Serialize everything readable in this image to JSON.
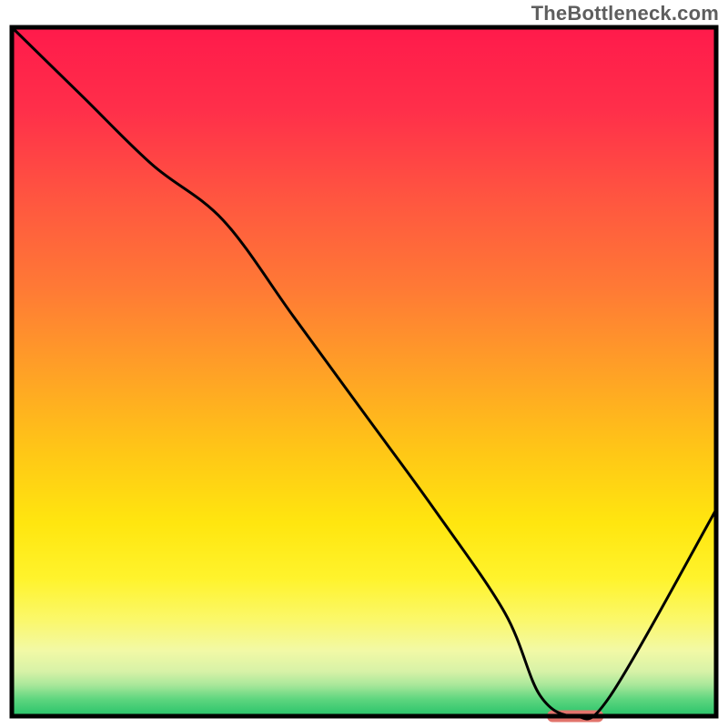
{
  "watermark": "TheBottleneck.com",
  "chart_data": {
    "type": "line",
    "title": "",
    "xlabel": "",
    "ylabel": "",
    "xlim": [
      0,
      100
    ],
    "ylim": [
      0,
      100
    ],
    "grid": false,
    "legend": false,
    "series": [
      {
        "name": "bottleneck-curve",
        "x": [
          0,
          10,
          20,
          30,
          40,
          50,
          60,
          70,
          75,
          80,
          85,
          100
        ],
        "y": [
          100,
          90,
          80,
          72,
          58,
          44,
          30,
          15,
          3,
          0,
          3,
          30
        ]
      }
    ],
    "marker": {
      "name": "optimal-range",
      "x_start": 76,
      "x_end": 84,
      "y": 0,
      "color": "#e2746c"
    },
    "background_gradient": {
      "stops": [
        {
          "offset": 0.0,
          "color": "#ff1a4b"
        },
        {
          "offset": 0.12,
          "color": "#ff2f4a"
        },
        {
          "offset": 0.25,
          "color": "#ff5640"
        },
        {
          "offset": 0.38,
          "color": "#ff7a35"
        },
        {
          "offset": 0.5,
          "color": "#ffa126"
        },
        {
          "offset": 0.62,
          "color": "#ffc816"
        },
        {
          "offset": 0.72,
          "color": "#ffe60f"
        },
        {
          "offset": 0.8,
          "color": "#fff32c"
        },
        {
          "offset": 0.86,
          "color": "#fbf86a"
        },
        {
          "offset": 0.905,
          "color": "#f2f9a6"
        },
        {
          "offset": 0.935,
          "color": "#d7f2a7"
        },
        {
          "offset": 0.955,
          "color": "#a8e79a"
        },
        {
          "offset": 0.975,
          "color": "#5fd67f"
        },
        {
          "offset": 1.0,
          "color": "#27c36a"
        }
      ]
    }
  }
}
